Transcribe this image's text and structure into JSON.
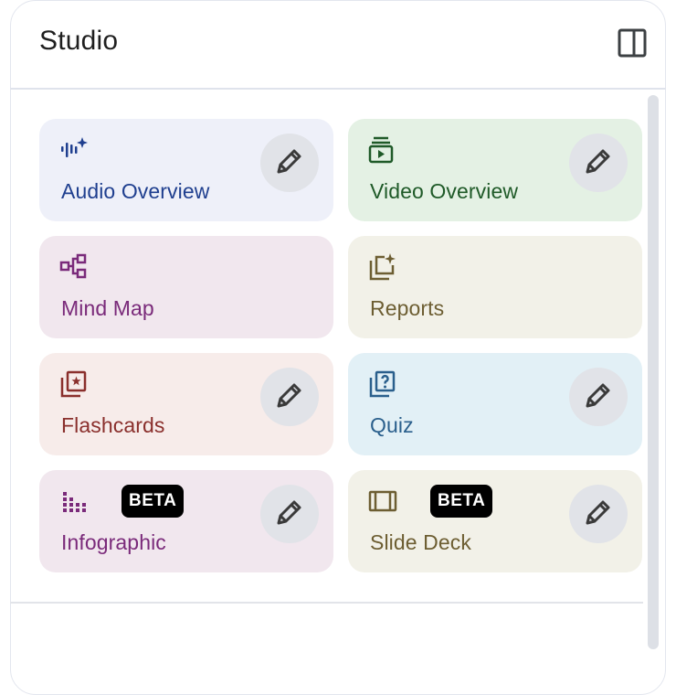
{
  "header": {
    "title": "Studio",
    "toggle_icon": "side-panel-icon"
  },
  "tiles": [
    {
      "id": "audio-overview",
      "label": "Audio Overview",
      "icon": "audio-sparkle-icon",
      "edit": true,
      "beta": "",
      "bg": "#eef0f9",
      "fg": "#1f3f8f"
    },
    {
      "id": "video-overview",
      "label": "Video Overview",
      "icon": "video-stack-icon",
      "edit": true,
      "beta": "",
      "bg": "#e4f1e4",
      "fg": "#1f5a28"
    },
    {
      "id": "mind-map",
      "label": "Mind Map",
      "icon": "mind-map-icon",
      "edit": false,
      "beta": "",
      "bg": "#f1e7ee",
      "fg": "#7a2a7a"
    },
    {
      "id": "reports",
      "label": "Reports",
      "icon": "reports-sparkle-icon",
      "edit": false,
      "beta": "",
      "bg": "#f2f1e8",
      "fg": "#6d5e32"
    },
    {
      "id": "flashcards",
      "label": "Flashcards",
      "icon": "flashcards-icon",
      "edit": true,
      "beta": "",
      "bg": "#f7ecea",
      "fg": "#8a2f2c"
    },
    {
      "id": "quiz",
      "label": "Quiz",
      "icon": "quiz-icon",
      "edit": true,
      "beta": "",
      "bg": "#e2f0f6",
      "fg": "#2a5f8c"
    },
    {
      "id": "infographic",
      "label": "Infographic",
      "icon": "infographic-icon",
      "edit": true,
      "beta": "BETA",
      "bg": "#f1e7ee",
      "fg": "#7a2a7a"
    },
    {
      "id": "slide-deck",
      "label": "Slide Deck",
      "icon": "slide-deck-icon",
      "edit": true,
      "beta": "BETA",
      "bg": "#f2f1e8",
      "fg": "#6d5e32"
    }
  ],
  "colors": {
    "edit_button_bg": "#e1e3e8",
    "pencil": "#3a3a3a"
  }
}
